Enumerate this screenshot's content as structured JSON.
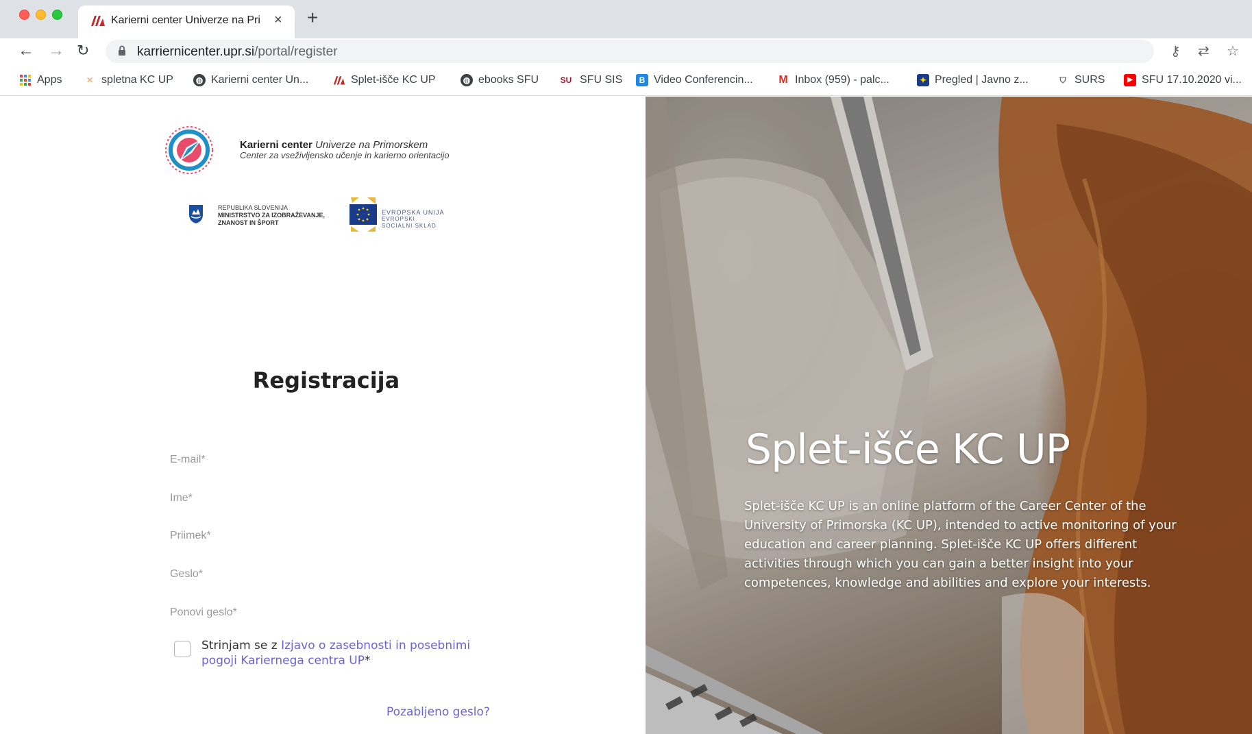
{
  "browser": {
    "tab_title": "Karierni center Univerze na Pri",
    "tab_close": "×",
    "new_tab": "+",
    "url_host": "karriernicenter.upr.si",
    "url_path": "/portal/register",
    "nav": {
      "back": "←",
      "forward": "→",
      "reload": "↻"
    },
    "toolbar_icons": {
      "key": "⚷",
      "translate": "⇄",
      "star": "☆"
    }
  },
  "bookmarks": [
    {
      "label": "Apps",
      "icon": "apps-grid-icon",
      "color": "#ea4335"
    },
    {
      "label": "spletna KC UP",
      "icon": "kc-icon",
      "color": "#f2b27a"
    },
    {
      "label": "Karierni center Un...",
      "icon": "globe-icon",
      "color": "#3c4043"
    },
    {
      "label": "Splet-išče KC UP",
      "icon": "upr-icon",
      "color": "#c62828"
    },
    {
      "label": "ebooks SFU",
      "icon": "globe-icon",
      "color": "#3c4043"
    },
    {
      "label": "SFU SIS",
      "icon": "sfu-icon",
      "color": "#a6192e"
    },
    {
      "label": "Video Conferencin...",
      "icon": "video-icon",
      "color": "#1e88e5"
    },
    {
      "label": "Inbox (959) - palc...",
      "icon": "gmail-icon",
      "color": "#d93025"
    },
    {
      "label": "Pregled | Javno z...",
      "icon": "eu-icon",
      "color": "#1a3a8a"
    },
    {
      "label": "SURS",
      "icon": "shield-icon",
      "color": "#555555"
    },
    {
      "label": "SFU 17.10.2020 vi...",
      "icon": "youtube-icon",
      "color": "#ff0000"
    }
  ],
  "header": {
    "kc_title_bold": "Karierni center",
    "kc_title_rest": " Univerze na Primorskem",
    "kc_subtitle": "Center za vseživljensko učenje in karierno orientacijo",
    "gov_line1": "REPUBLIKA SLOVENIJA",
    "gov_line2": "MINISTRSTVO ZA IZOBRAŽEVANJE,",
    "gov_line3": "ZNANOST IN ŠPORT",
    "eu_line1": "EVROPSKA UNIJA",
    "eu_line2": "EVROPSKI",
    "eu_line3": "SOCIALNI SKLAD"
  },
  "form": {
    "title": "Registracija",
    "email_placeholder": "E-mail*",
    "name_placeholder": "Ime*",
    "surname_placeholder": "Priimek*",
    "password_placeholder": "Geslo*",
    "repeat_password_placeholder": "Ponovi geslo*",
    "consent_prefix": "Strinjam se z ",
    "consent_link": "Izjavo o zasebnosti in posebnimi pogoji Kariernega centra UP",
    "consent_suffix": "*",
    "forgot_password": "Pozabljeno geslo?"
  },
  "hero": {
    "title": "Splet-išče KC UP",
    "description": "Splet-išče KC UP is an online platform of the Career Center of the University of Primorska (KC UP), intended to active monitoring of your education and career planning. Splet-išče KC UP offers different activities through which you can gain a better insight into your competences, knowledge and abilities and explore your interests."
  },
  "colors": {
    "accent_link": "#6c63d6",
    "chrome_tabstrip": "#dee1e6",
    "omnibox": "#f1f3f4"
  }
}
